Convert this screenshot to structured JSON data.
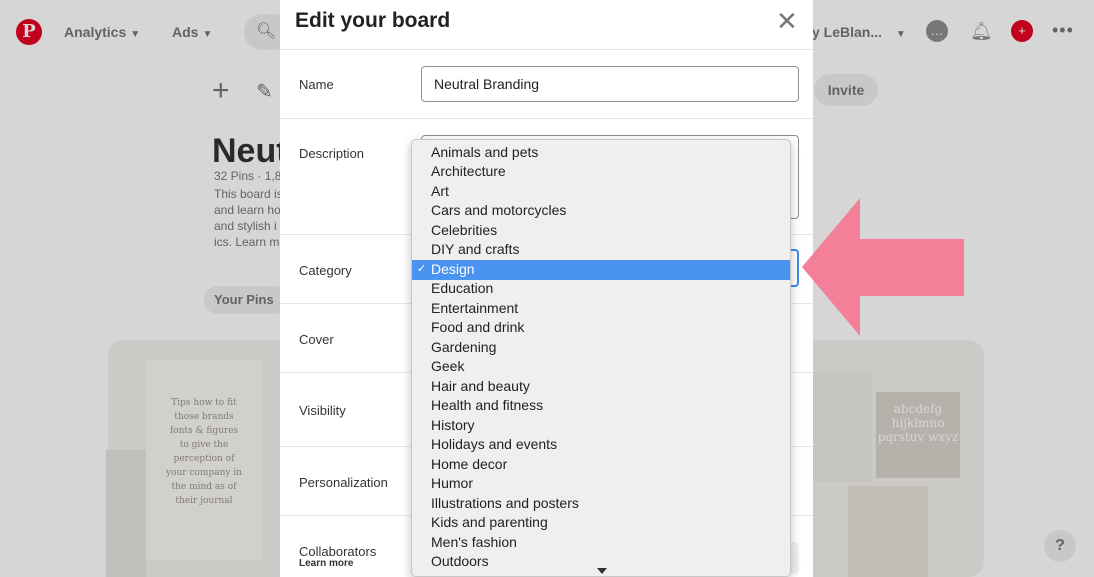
{
  "background": {
    "nav": {
      "analytics": "Analytics",
      "ads": "Ads",
      "user": "y LeBlan..."
    },
    "board": {
      "title": "Neut",
      "meta": "32 Pins · 1,8",
      "desc_lines": [
        "This board is",
        "and learn ho",
        "and stylish i",
        "ics. Learn m"
      ],
      "your_pins": "Your Pins",
      "invite": "Invite"
    },
    "tile_left_text": "Tips how to fit those brands fonts & figures to give the perception of your company in the mind as of their journal",
    "tile_right_text": "abcdefg hijklmno pqrstuv wxyz",
    "help": "?"
  },
  "modal": {
    "title": "Edit your board",
    "close": "✕",
    "rows": {
      "name": {
        "label": "Name",
        "value": "Neutral Branding"
      },
      "description": {
        "label": "Description"
      },
      "category": {
        "label": "Category"
      },
      "cover": {
        "label": "Cover"
      },
      "visibility": {
        "label": "Visibility"
      },
      "personalization": {
        "label": "Personalization"
      },
      "collaborators": {
        "label": "Collaborators",
        "sub": "Learn more"
      }
    }
  },
  "category_dropdown": {
    "selected": "Design",
    "check": "✓",
    "options": [
      "Animals and pets",
      "Architecture",
      "Art",
      "Cars and motorcycles",
      "Celebrities",
      "DIY and crafts",
      "Design",
      "Education",
      "Entertainment",
      "Food and drink",
      "Gardening",
      "Geek",
      "Hair and beauty",
      "Health and fitness",
      "History",
      "Holidays and events",
      "Home decor",
      "Humor",
      "Illustrations and posters",
      "Kids and parenting",
      "Men's fashion",
      "Outdoors"
    ]
  },
  "colors": {
    "selection": "#4a93f0",
    "annotation_arrow": "#f47f98",
    "brand": "#e60023"
  }
}
